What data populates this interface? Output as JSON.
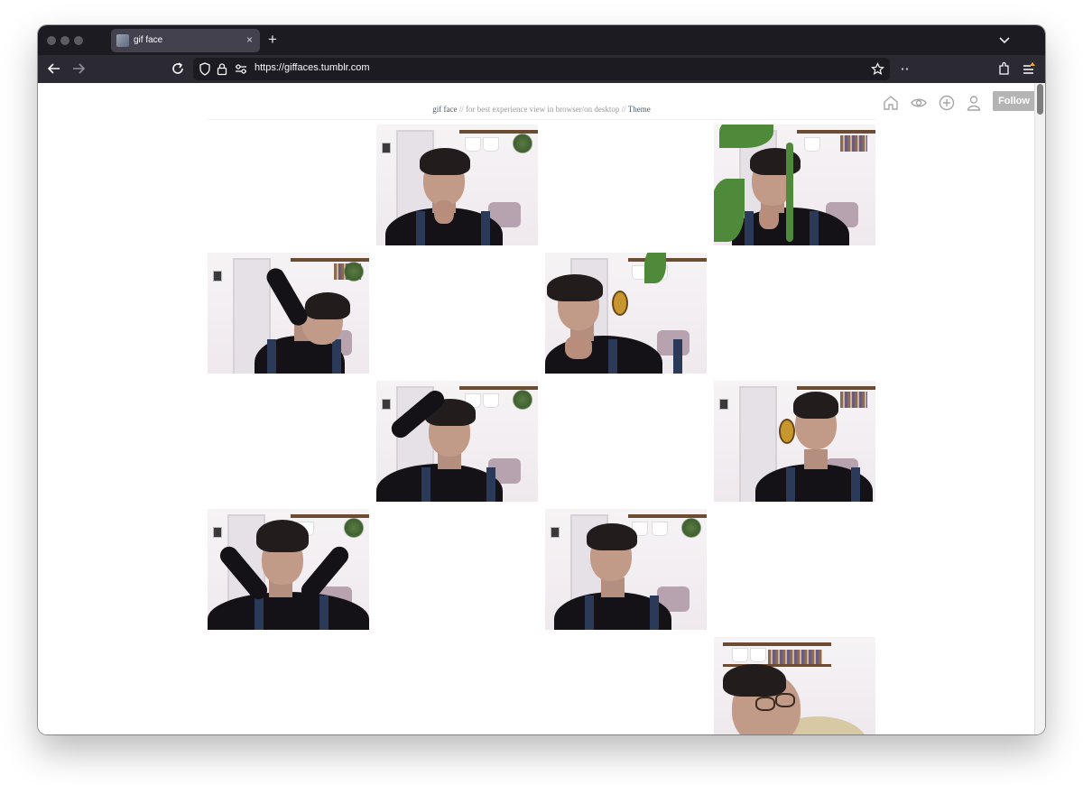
{
  "browser": {
    "tab": {
      "title": "gif face",
      "close_icon": "×"
    },
    "new_tab_icon": "+",
    "url": "https://giffaces.tumblr.com"
  },
  "blog": {
    "title_link": "gif face",
    "tagline": " // for best experience view in browser/on desktop // ",
    "theme_link": "Theme",
    "follow_label": "Follow"
  },
  "posts": [
    {
      "pose": "chin on hand"
    },
    {
      "pose": "behind plant"
    },
    {
      "pose": "arm over head"
    },
    {
      "pose": "fist to mouth"
    },
    {
      "pose": "hand in hair"
    },
    {
      "pose": "neutral"
    },
    {
      "pose": "hands behind head"
    },
    {
      "pose": "looking down"
    },
    {
      "pose": "close up with glasses"
    }
  ]
}
